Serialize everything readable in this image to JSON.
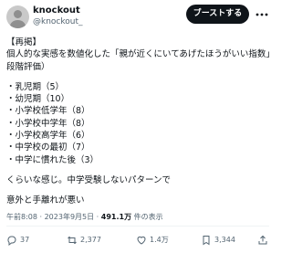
{
  "post": {
    "author_name": "knockout",
    "author_handle": "@knockout_",
    "follow_button": "ブーストする",
    "lines": [
      "【再掲】",
      "個人的な実感を数値化した「親が近くにいてあげたほうがいい指数」（10",
      "段階評価）",
      "",
      "・乳児期（5）",
      "・幼児期（10）",
      "・小学校低学年（8）",
      "・小学校中学年（8）",
      "・小学校高学年（6）",
      "・中学校の最初（7）",
      "・中学に慣れた後（3）",
      "",
      "くらいな感じ。中学受験しないパターンで",
      "",
      "意外と手離れが悪い"
    ],
    "timestamp": "午前8:08 · 2023年9月5日 · ",
    "views_count": "491.1万",
    "views_label": " 件の表示",
    "replies": "37",
    "reposts": "2,377",
    "likes": "1.4万",
    "bookmarks": "3,344"
  }
}
